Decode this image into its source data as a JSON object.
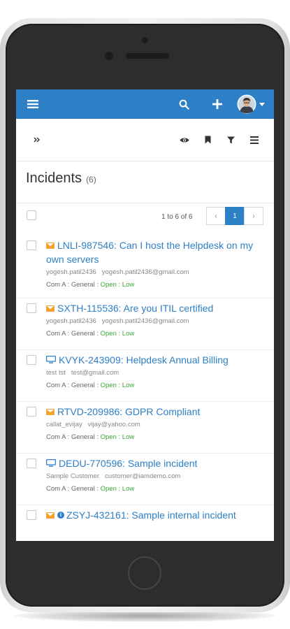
{
  "app": {
    "accent": "#2d7fc6",
    "header": {
      "menu_icon": "hamburger-icon",
      "search_icon": "search-icon",
      "add_icon": "plus-icon",
      "avatar": "user-avatar",
      "dropdown_icon": "caret-down-icon"
    },
    "toolbar": {
      "expand_icon": "double-chevron-right-icon",
      "view_icon": "eye-icon",
      "bookmark_icon": "bookmark-icon",
      "filter_icon": "filter-icon",
      "list_icon": "list-icon"
    },
    "page": {
      "title": "Incidents",
      "count": "(6)"
    },
    "pagination": {
      "info": "1 to 6 of 6",
      "prev": "‹",
      "current": "1",
      "next": "›"
    },
    "incidents": [
      {
        "title": "LNLI-987546: Can I host the Helpdesk on my own servers",
        "icon": "envelope-icon",
        "user": "yogesh.patil2436",
        "email": "yogesh.patil2436@gmail.com",
        "company": "Com A : General :",
        "status": "Open",
        "priority": "Low"
      },
      {
        "title": "SXTH-115536: Are you ITIL certified",
        "icon": "envelope-icon",
        "user": "yogesh.patil2436",
        "email": "yogesh.patil2436@gmail.com",
        "company": "Com A : General :",
        "status": "Open",
        "priority": "Low"
      },
      {
        "title": "KVYK-243909: Helpdesk Annual Billing",
        "icon": "monitor-icon",
        "user": "test tst",
        "email": "test@gmail.com",
        "company": "Com A : General :",
        "status": "Open",
        "priority": "Low"
      },
      {
        "title": "RTVD-209986: GDPR Compliant",
        "icon": "envelope-icon",
        "user": "callat_evijay",
        "email": "vijay@yahoo.com",
        "company": "Com A : General :",
        "status": "Open",
        "priority": "Low"
      },
      {
        "title": "DEDU-770596: Sample incident",
        "icon": "monitor-icon",
        "user": "Sample Customer",
        "email": "customer@iamdemo.com",
        "company": "Com A : General :",
        "status": "Open",
        "priority": "Low"
      },
      {
        "title": "ZSYJ-432161: Sample internal incident",
        "icon": "envelope-icon",
        "secondary_icon": "info-icon"
      }
    ]
  }
}
